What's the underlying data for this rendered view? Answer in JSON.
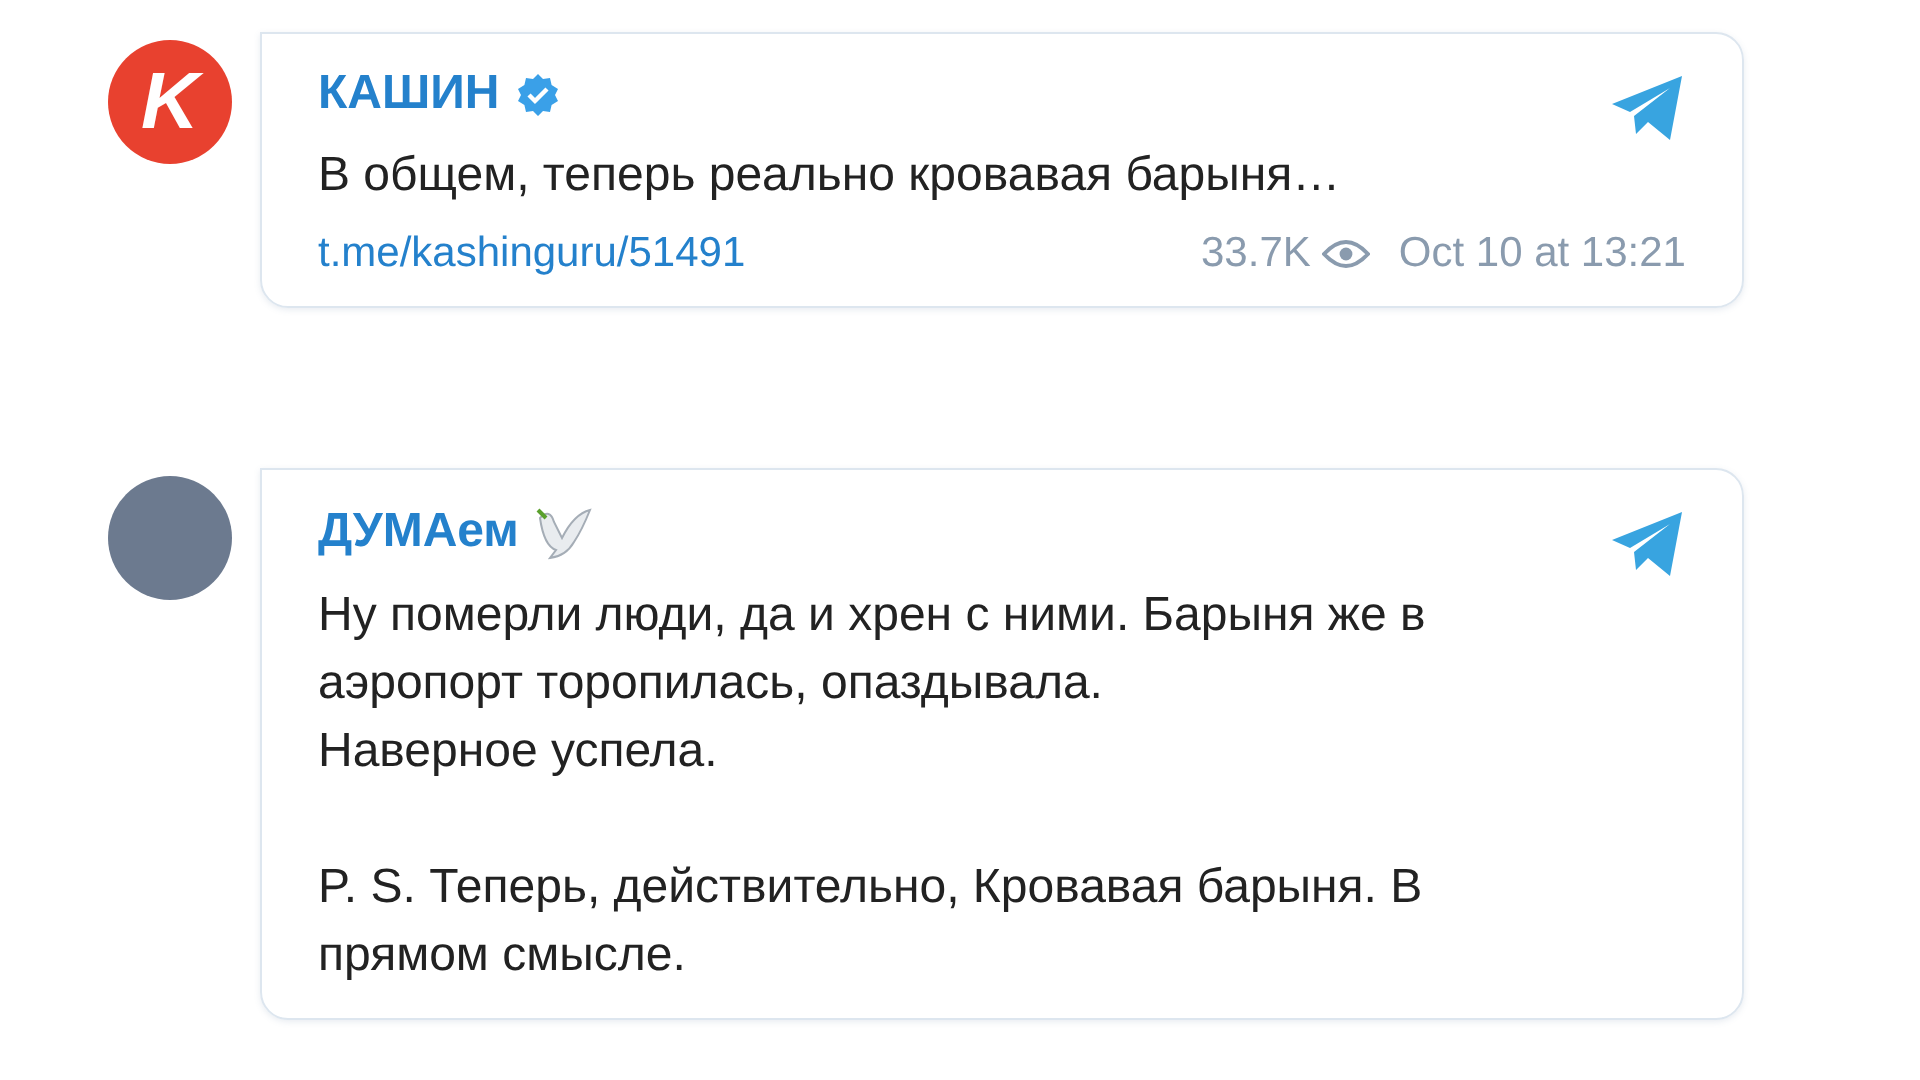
{
  "posts": [
    {
      "avatar": {
        "kind": "logo",
        "letter": "K"
      },
      "channel": "КАШИН",
      "verified": true,
      "dove": false,
      "text": "В общем, теперь реально кровавая барыня…",
      "link": "t.me/kashinguru/51491",
      "views": "33.7K",
      "date": "Oct 10 at 13:21"
    },
    {
      "avatar": {
        "kind": "photo"
      },
      "channel": "ДУМАем",
      "verified": false,
      "dove": true,
      "text": "Ну померли люди, да и хрен с ними. Барыня же в аэропорт торопилась, опаздывала.\nНаверное успела.\n\nP. S. Теперь, действительно, Кровавая барыня. В прямом смысле."
    }
  ]
}
